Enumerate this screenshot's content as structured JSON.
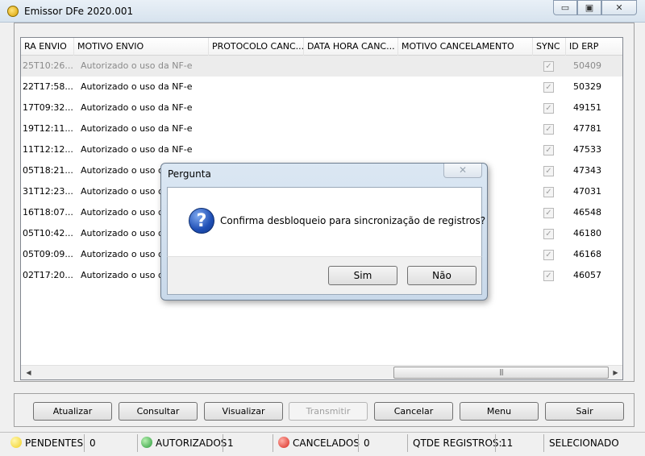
{
  "window": {
    "title": "Emissor DFe 2020.001",
    "minimize_glyph": "▭",
    "maximize_glyph": "▣",
    "close_glyph": "✕"
  },
  "grid": {
    "headers": [
      "RA ENVIO",
      "MOTIVO ENVIO",
      "PROTOCOLO CANC...",
      "DATA HORA CANC...",
      "MOTIVO CANCELAMENTO",
      "SYNC",
      "ID ERP"
    ],
    "rows": [
      {
        "data_envio": "25T10:26...",
        "motivo": "Autorizado o uso da NF-e",
        "sync": "✓",
        "id_erp": "50409",
        "selected": true
      },
      {
        "data_envio": "22T17:58...",
        "motivo": "Autorizado o uso da NF-e",
        "sync": "✓",
        "id_erp": "50329"
      },
      {
        "data_envio": "17T09:32...",
        "motivo": "Autorizado o uso da NF-e",
        "sync": "✓",
        "id_erp": "49151"
      },
      {
        "data_envio": "19T12:11...",
        "motivo": "Autorizado o uso da NF-e",
        "sync": "✓",
        "id_erp": "47781"
      },
      {
        "data_envio": "11T12:12...",
        "motivo": "Autorizado o uso da NF-e",
        "sync": "✓",
        "id_erp": "47533"
      },
      {
        "data_envio": "05T18:21...",
        "motivo": "Autorizado o uso da NF-e",
        "sync": "✓",
        "id_erp": "47343"
      },
      {
        "data_envio": "31T12:23...",
        "motivo": "Autorizado o uso da NF-e",
        "sync": "✓",
        "id_erp": "47031"
      },
      {
        "data_envio": "16T18:07...",
        "motivo": "Autorizado o uso da NF-e",
        "sync": "✓",
        "id_erp": "46548"
      },
      {
        "data_envio": "05T10:42...",
        "motivo": "Autorizado o uso da NF-e",
        "sync": "✓",
        "id_erp": "46180"
      },
      {
        "data_envio": "05T09:09...",
        "motivo": "Autorizado o uso da NF-e",
        "sync": "✓",
        "id_erp": "46168"
      },
      {
        "data_envio": "02T17:20...",
        "motivo": "Autorizado o uso da NF-e",
        "sync": "✓",
        "id_erp": "46057"
      }
    ],
    "scroll_left_glyph": "◀",
    "scroll_right_glyph": "▶",
    "scroll_thumb_grip": "|||"
  },
  "buttons": {
    "atualizar": "Atualizar",
    "consultar": "Consultar",
    "visualizar": "Visualizar",
    "transmitir": "Transmitir",
    "cancelar": "Cancelar",
    "menu": "Menu",
    "sair": "Sair"
  },
  "status": {
    "pendentes_label": "PENDENTES",
    "pendentes_value": "0",
    "pendentes_color": "#f2d020",
    "autorizados_label": "AUTORIZADOS",
    "autorizados_value": "1",
    "autorizados_color": "#2a9a3a",
    "cancelados_label": "CANCELADOS",
    "cancelados_value": "0",
    "cancelados_color": "#d8281e",
    "qtde_label": "QTDE REGISTROS:",
    "qtde_value": "11",
    "selecionado_label": "SELECIONADO"
  },
  "dialog": {
    "title": "Pergunta",
    "close_glyph": "✕",
    "icon": "question-icon",
    "icon_glyph": "?",
    "message": "Confirma desbloqueio para sincronização de registros?",
    "yes_label": "Sim",
    "no_label": "Não"
  }
}
